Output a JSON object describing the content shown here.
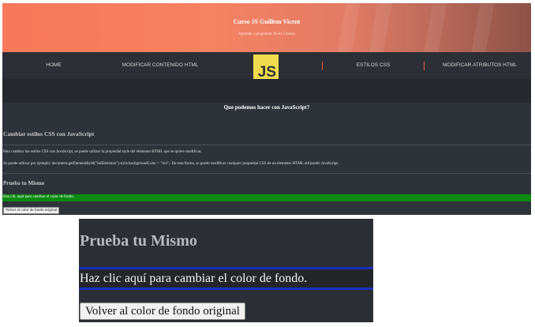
{
  "hero": {
    "title": "Curso JS Guillem Vicent",
    "subtitle": "Aprende a programar JS en 3 meses"
  },
  "nav": {
    "items": [
      {
        "label": "HOME"
      },
      {
        "label": "MODIFICAR CONTENIDO HTML"
      },
      {
        "label": "ESTILOS CSS"
      },
      {
        "label": "MODIFICAR ATRIBUTOS HTML"
      }
    ],
    "logo_text": "JS"
  },
  "colors": {
    "hero_accent": "#f7785a",
    "nav_background": "#2c2f35",
    "logo_yellow": "#f0db4f",
    "green_bar": "#0a8a0f",
    "zoom_bar_border": "#1a2fb8"
  },
  "content": {
    "heading": "Que podemos hacer con JavaScript?",
    "section1_title": "Cambiar estilos CSS con JavaScript",
    "paragraph1": "Para cambiar los estilos CSS con JavaScript, se puede utilizar la propiedad style del elemento HTML que se quiere modificar.",
    "paragraph2": "Se puede utilizar por ejemplo: document.getElementById(\"miElemento\").style.backgroundColor = \"red\";. De esta forma, se puede modificar cualquier propiedad CSS de un elemento HTML utilizando JavaScript.",
    "section2_title": "Prueba tu Mismo",
    "green_bar_text": "Haz clic aquí para cambiar el color de fondo.",
    "reset_button": "Volver al color de fondo original"
  },
  "zoom": {
    "title": "Prueba tu Mismo",
    "bar_text": "Haz clic aquí para cambiar el color de fondo.",
    "button_label": "Volver al color de fondo original"
  }
}
